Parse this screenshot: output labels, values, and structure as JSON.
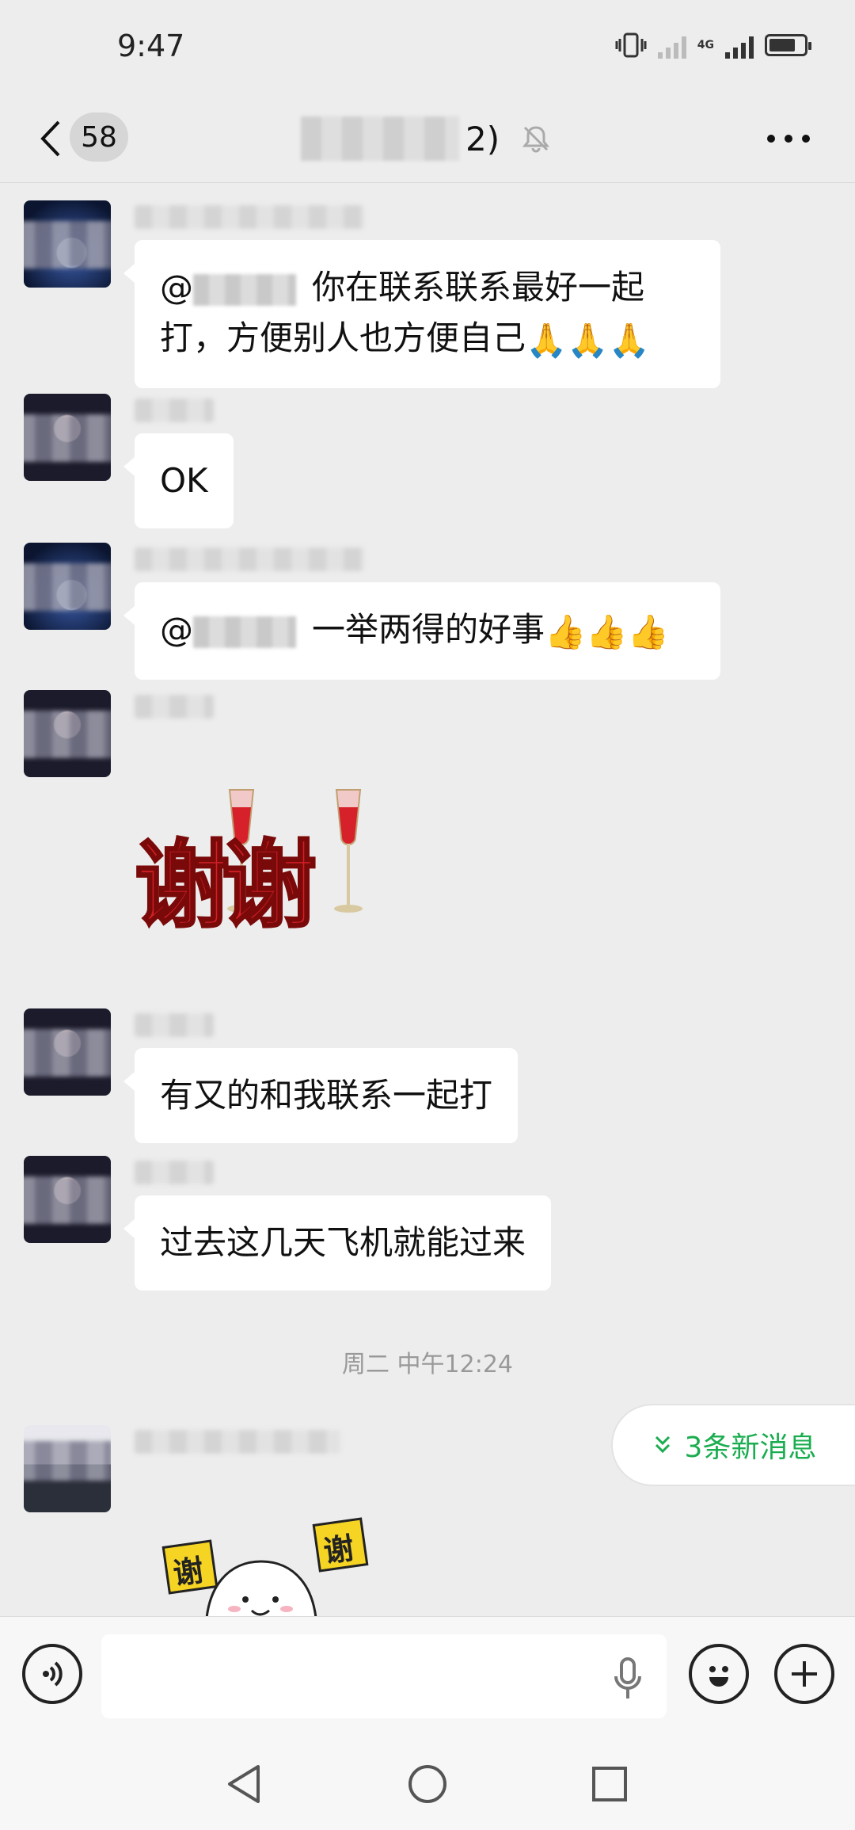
{
  "status_bar": {
    "time": "9:47",
    "network_label": "4G"
  },
  "header": {
    "back_icon": "chevron-left-icon",
    "unread_count": "58",
    "title_suffix": "2)",
    "mute_icon": "bell-off-icon",
    "more_icon": "more-horizontal-icon"
  },
  "messages": [
    {
      "type": "text",
      "text_after_mention": "你在联系联系最好一起",
      "text_line2": "打，方便别人也方便自己",
      "emoji": "🙏🙏🙏"
    },
    {
      "type": "text",
      "text": "OK"
    },
    {
      "type": "text",
      "text_after_mention": "一举两得的好事",
      "emoji": "👍👍👍"
    },
    {
      "type": "sticker",
      "sticker": "thanks-cheers-sticker",
      "sticker_text": "谢谢"
    },
    {
      "type": "text",
      "text": "有又的和我联系一起打"
    },
    {
      "type": "text",
      "text": "过去这几天飞机就能过来"
    },
    {
      "type": "sticker",
      "sticker": "thanks-ghost-sticker",
      "sticker_text": "谢"
    }
  ],
  "mention_prefix": "@",
  "time_divider": "周二 中午12:24",
  "new_messages_pill": {
    "label": "3条新消息",
    "icon": "double-chevron-down-icon",
    "accent": "#1aad4f"
  },
  "input_bar": {
    "voice_icon": "voice-icon",
    "mic_icon": "mic-icon",
    "emoji_icon": "smile-icon",
    "plus_icon": "plus-icon",
    "placeholder": ""
  },
  "nav_bar": {
    "back_icon": "triangle-back-icon",
    "home_icon": "circle-home-icon",
    "recents_icon": "square-recents-icon"
  }
}
